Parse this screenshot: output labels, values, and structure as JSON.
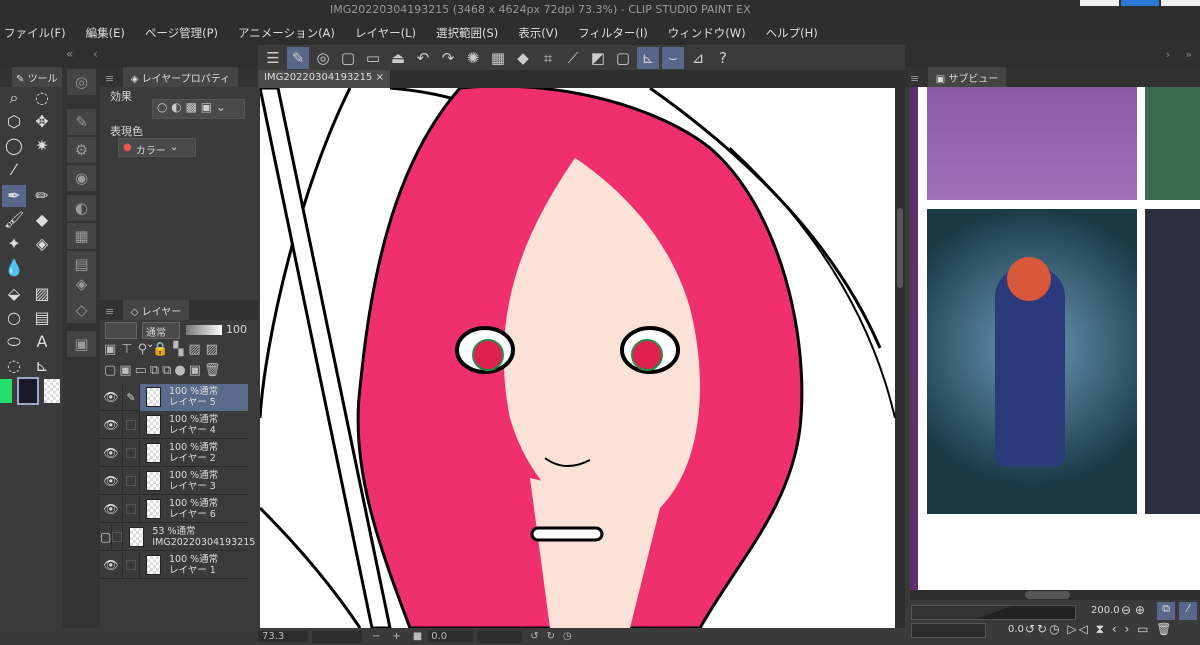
{
  "window": {
    "title": "IMG20220304193215 (3468 x 4624px 72dpi 73.3%)  - CLIP STUDIO PAINT EX"
  },
  "menu": [
    "ファイル(F)",
    "編集(E)",
    "ページ管理(P)",
    "アニメーション(A)",
    "レイヤー(L)",
    "選択範囲(S)",
    "表示(V)",
    "フィルター(I)",
    "ウィンドウ(W)",
    "ヘルプ(H)"
  ],
  "tool_panel": {
    "tab": "ツール",
    "tools": [
      "zoom-icon",
      "lasso-select-icon",
      "object-select-icon",
      "move-icon",
      "lasso-icon",
      "magic-wand-icon",
      "eyedropper-icon",
      "pen-icon",
      "pencil-icon",
      "brush-icon",
      "eraser-icon",
      "airbrush-icon",
      "blend-icon",
      "fill-icon",
      "gradient-icon",
      "shape-icon",
      "frame-icon",
      "text-icon",
      "balloon-icon",
      "correction-icon"
    ],
    "colors": {
      "main": "#22e06a",
      "sub": "#1a1a2a"
    }
  },
  "layer_property": {
    "tab": "レイヤープロパティ",
    "effect_label": "効果",
    "color_label": "表現色",
    "color_value": "カラー"
  },
  "layer_panel": {
    "tab": "レイヤー",
    "blend_mode": "通常",
    "opacity": "100",
    "layers": [
      {
        "opacity_mode": "100 %通常",
        "name": "レイヤー 5",
        "visible": true,
        "selected": true
      },
      {
        "opacity_mode": "100 %通常",
        "name": "レイヤー 4",
        "visible": true
      },
      {
        "opacity_mode": "100 %通常",
        "name": "レイヤー 2",
        "visible": true
      },
      {
        "opacity_mode": "100 %通常",
        "name": "レイヤー 3",
        "visible": true
      },
      {
        "opacity_mode": "100 %通常",
        "name": "レイヤー 6",
        "visible": true
      },
      {
        "opacity_mode": "53 %通常",
        "name": "IMG20220304193215",
        "visible": false
      },
      {
        "opacity_mode": "100 %通常",
        "name": "レイヤー 1",
        "visible": true
      }
    ]
  },
  "document": {
    "tab": "IMG20220304193215",
    "close": "×"
  },
  "status": {
    "zoom": "73.3",
    "minus": "−",
    "plus": "+",
    "angle": "0.0"
  },
  "subview": {
    "tab": "サブビュー",
    "zoom": "200.0",
    "angle": "0.0"
  },
  "accent": "#f0306e"
}
